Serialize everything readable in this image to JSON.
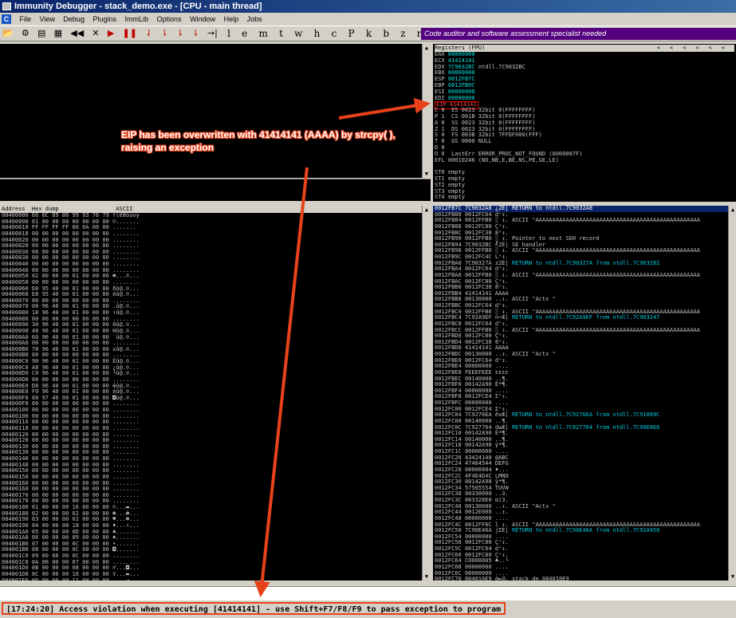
{
  "window": {
    "title": "Immunity Debugger - stack_demo.exe - [CPU - main thread]"
  },
  "menu": [
    "File",
    "View",
    "Debug",
    "Plugins",
    "ImmLib",
    "Options",
    "Window",
    "Help",
    "Jobs"
  ],
  "toolbar": {
    "controls": [
      "◀◀",
      "✕",
      "▶",
      "❚❚",
      "⇃",
      "⇂",
      "⇂",
      "⇂",
      "→|"
    ],
    "letters": [
      "l",
      "e",
      "m",
      "t",
      "w",
      "h",
      "c",
      "P",
      "k",
      "b",
      "z",
      "r",
      "...",
      "s",
      "?"
    ],
    "banner": "Code auditor and software assessment specialist needed"
  },
  "registers": {
    "header": "Registers (FPU)",
    "rows": [
      {
        "name": "EAX",
        "value": "00000000",
        "comment": ""
      },
      {
        "name": "ECX",
        "value": "41414141",
        "comment": ""
      },
      {
        "name": "EDX",
        "value": "7C9032BC",
        "comment": "ntdll.7C9032BC"
      },
      {
        "name": "EBX",
        "value": "00000000",
        "comment": ""
      },
      {
        "name": "ESP",
        "value": "0012FB7C",
        "comment": ""
      },
      {
        "name": "EBP",
        "value": "0012FB9C",
        "comment": ""
      },
      {
        "name": "ESI",
        "value": "00000000",
        "comment": ""
      },
      {
        "name": "EDI",
        "value": "00000000",
        "comment": ""
      }
    ],
    "eip": "EIP 41414141",
    "flags": [
      "C 0  ES 0023 32bit 0(FFFFFFFF)",
      "P 1  CS 001B 32bit 0(FFFFFFFF)",
      "A 0  SS 0023 32bit 0(FFFFFFFF)",
      "Z 1  DS 0023 32bit 0(FFFFFFFF)",
      "S 0  FS 003B 32bit 7FFDF000(FFF)",
      "T 0  GS 0000 NULL",
      "D 0",
      "O 0  LastErr ERROR_PROC_NOT_FOUND (0000007F)",
      "EFL 00010246 (NO,NB,E,BE,NS,PE,GE,LE)",
      "",
      "ST0 empty",
      "ST1 empty",
      "ST2 empty",
      "ST3 empty",
      "ST4 empty"
    ]
  },
  "dump": {
    "header": "Address  Hex dump                 ASCII",
    "rows": [
      "00400000 66 6C 89 86 99 93 76 79 flë8öùvy",
      "00400008 01 00 00 00 00 00 00 00 ☺.......",
      "00400010 FF FF FF FF 00 0A 00 00 .......",
      "00400018 00 00 00 00 00 00 00 00 ........",
      "00400020 00 00 00 00 00 00 00 00 ........",
      "00400028 00 00 00 00 00 00 00 00 ........",
      "00400030 00 00 00 00 00 00 00 00 ........",
      "00400038 00 00 00 00 00 00 00 00 ........",
      "00400040 00 00 00 00 00 00 00 00 ........",
      "00400048 00 00 00 00 00 00 00 00 ........",
      "00400050 02 00 00 00 01 00 00 00 ☻...☺...",
      "00400058 00 00 00 00 00 00 00 00 ........",
      "00400060 D0 95 40 00 01 00 00 00 ðò@.☺...",
      "00400068 E8 95 40 00 01 00 00 00 èò@.☺...",
      "00400070 00 00 00 00 00 00 00 00 ........",
      "00400078 00 96 40 00 01 00 00 00 .û@.☺...",
      "00400080 18 96 40 00 01 00 00 00 ↑û@.☺...",
      "00400088 00 00 00 00 00 00 00 00 ........",
      "00400090 30 96 40 00 01 00 00 00 0û@.☺...",
      "00400098 48 96 40 00 01 00 00 00 Hû@.☺...",
      "004000A0 60 96 40 00 01 00 00 00 `û@.☺...",
      "004000A8 00 00 00 00 00 00 00 00 ........",
      "004000B0 78 96 40 00 01 00 00 00 xû@.☺...",
      "004000B8 00 00 00 00 00 00 00 00 ........",
      "004000C0 90 96 40 00 01 00 00 00 Éû@.☺...",
      "004000C8 A8 96 40 00 01 00 00 00 ¿û@.☺...",
      "004000D0 C0 96 40 00 01 00 00 00 └û@.☺...",
      "004000D8 00 00 00 00 00 00 00 00 ........",
      "004000E0 D8 96 40 00 01 00 00 00 ╪û@.☺...",
      "004000E8 F0 96 40 00 01 00 00 00 ≡û@.☺...",
      "004000F0 08 97 40 00 01 00 00 00 ◘ù@.☺...",
      "004000F8 00 00 00 00 00 00 00 00 ........",
      "00400100 00 00 00 00 00 00 00 00 ........",
      "00400108 00 00 00 00 00 00 00 00 ........",
      "00400110 00 00 00 00 00 00 00 00 ........",
      "00400118 00 00 00 00 00 00 00 00 ........",
      "00400120 00 00 00 00 00 00 00 00 ........",
      "00400128 00 00 00 00 00 00 00 00 ........",
      "00400130 00 00 00 00 00 00 00 00 ........",
      "00400138 00 00 00 00 00 00 00 00 ........",
      "00400140 00 00 00 00 00 00 00 00 ........",
      "00400148 00 00 00 00 00 00 00 00 ........",
      "00400150 00 00 00 00 00 00 00 00 ........",
      "00400158 00 00 00 00 00 00 00 00 ........",
      "00400160 00 00 00 00 00 00 00 00 ........",
      "00400168 00 00 00 00 00 00 00 00 ........",
      "00400170 00 00 00 00 00 00 00 00 ........",
      "00400178 00 00 00 00 00 00 00 00 ........",
      "00400180 01 00 00 00 16 00 00 00 ☺...▬...",
      "00400188 02 00 00 00 02 00 00 00 ☻...☻...",
      "00400190 03 00 00 00 02 00 00 00 ♥...☻...",
      "00400198 04 00 00 00 18 00 00 00 ♦...↑...",
      "004001A0 05 00 00 00 0D 00 00 00 ♣.......",
      "004001A8 06 00 00 00 09 00 00 00 ♠.......",
      "004001B0 07 00 00 00 0C 00 00 00 •.......",
      "004001B8 08 00 00 00 0C 00 00 00 ◘.......",
      "004001C0 09 00 00 00 0C 00 00 00 ........",
      "004001C8 0A 00 00 00 07 00 00 00 ........",
      "004001D0 0B 00 00 00 08 00 00 00 ♂...◘...",
      "004001D8 0C 00 00 00 16 00 00 00 ♀...▬...",
      "004001E0 0D 00 00 00 11 00 00 00 ....◄..."
    ]
  },
  "stack": {
    "rows": [
      {
        "addr": "0012FB7C",
        "val": "7C9032A8",
        "asc": "¿2É|",
        "cmt": "RETURN to ntdll.7C9032A8",
        "sel": true
      },
      {
        "addr": "0012FB80",
        "val": "0012FC64",
        "asc": "dⁿ↕.",
        "cmt": ""
      },
      {
        "addr": "0012FB84",
        "val": "0012FFB0",
        "asc": "░ ↕.",
        "cmt": "ASCII \"AAAAAAAAAAAAAAAAAAAAAAAAAAAAAAAAAAAAAAAAAAAAAAAAA"
      },
      {
        "addr": "0012FB88",
        "val": "0012FC80",
        "asc": "Çⁿ↕.",
        "cmt": ""
      },
      {
        "addr": "0012FB8C",
        "val": "0012FC38",
        "asc": "8ⁿ↕.",
        "cmt": ""
      },
      {
        "addr": "0012FB90",
        "val": "0012FFB0",
        "asc": "░ ↕.",
        "cmt": "Pointer to next SEH record"
      },
      {
        "addr": "0012FB94",
        "val": "7C9032BC",
        "asc": "╝2É|",
        "cmt": "SE handler"
      },
      {
        "addr": "0012FB98",
        "val": "0012FFB0",
        "asc": "░ ↕.",
        "cmt": "ASCII \"AAAAAAAAAAAAAAAAAAAAAAAAAAAAAAAAAAAAAAAAAAAAAAAAA"
      },
      {
        "addr": "0012FB9C",
        "val": "0012FC4C",
        "asc": "Lⁿ↕.",
        "cmt": ""
      },
      {
        "addr": "0012FBA0",
        "val": "7C90327A",
        "asc": "z2É|",
        "cmt": "RETURN to ntdll.7C90327A from ntdll.7C903282"
      },
      {
        "addr": "0012FBA4",
        "val": "0012FC64",
        "asc": "dⁿ↕.",
        "cmt": ""
      },
      {
        "addr": "0012FBA8",
        "val": "0012FFB0",
        "asc": "░ ↕.",
        "cmt": "ASCII \"AAAAAAAAAAAAAAAAAAAAAAAAAAAAAAAAAAAAAAAAAAAAAAAAA"
      },
      {
        "addr": "0012FBAC",
        "val": "0012FC80",
        "asc": "Çⁿ↕.",
        "cmt": ""
      },
      {
        "addr": "0012FBB0",
        "val": "0012FC38",
        "asc": "8ⁿ↕.",
        "cmt": ""
      },
      {
        "addr": "0012FBB4",
        "val": "41414141",
        "asc": "AAAA",
        "cmt": ""
      },
      {
        "addr": "0012FBB8",
        "val": "00130000",
        "asc": "..↕.",
        "cmt": "ASCII \"Actx \""
      },
      {
        "addr": "0012FBBC",
        "val": "0012FC64",
        "asc": "dⁿ↕.",
        "cmt": ""
      },
      {
        "addr": "0012FBC0",
        "val": "0012FFB0",
        "asc": "░ ↕.",
        "cmt": "ASCII \"AAAAAAAAAAAAAAAAAAAAAAAAAAAAAAAAAAAAAAAAAAAAAAAAA"
      },
      {
        "addr": "0012FBC4",
        "val": "7C92A9EF",
        "asc": "n⌐Æ|",
        "cmt": "RETURN to ntdll.7C92A9EF from ntdll.7C903247"
      },
      {
        "addr": "0012FBC8",
        "val": "0012FC64",
        "asc": "dⁿ↕.",
        "cmt": ""
      },
      {
        "addr": "0012FBCC",
        "val": "0012FFB0",
        "asc": "░ ↕.",
        "cmt": "ASCII \"AAAAAAAAAAAAAAAAAAAAAAAAAAAAAAAAAAAAAAAAAAAAAAAAA"
      },
      {
        "addr": "0012FBD0",
        "val": "0012FC80",
        "asc": "Çⁿ↕.",
        "cmt": ""
      },
      {
        "addr": "0012FBD4",
        "val": "0012FC38",
        "asc": "8ⁿ↕.",
        "cmt": ""
      },
      {
        "addr": "0012FBD8",
        "val": "41414141",
        "asc": "AAAA",
        "cmt": ""
      },
      {
        "addr": "0012FBDC",
        "val": "00130000",
        "asc": "..↕.",
        "cmt": "ASCII \"Actx \""
      },
      {
        "addr": "0012FBE0",
        "val": "0012FC64",
        "asc": "dⁿ↕.",
        "cmt": ""
      },
      {
        "addr": "0012FBE4",
        "val": "00000000",
        "asc": "....",
        "cmt": ""
      },
      {
        "addr": "0012FBE8",
        "val": "FEEEFEEE",
        "asc": "εεεε",
        "cmt": ""
      },
      {
        "addr": "0012FBEC",
        "val": "00140000",
        "asc": "..¶.",
        "cmt": ""
      },
      {
        "addr": "0012FBF0",
        "val": "00142A90",
        "asc": "É*¶.",
        "cmt": ""
      },
      {
        "addr": "0012FBF4",
        "val": "00000000",
        "asc": "....",
        "cmt": ""
      },
      {
        "addr": "0012FBF8",
        "val": "0012FCE4",
        "asc": "Σⁿ↕.",
        "cmt": ""
      },
      {
        "addr": "0012FBFC",
        "val": "00000000",
        "asc": "....",
        "cmt": ""
      },
      {
        "addr": "0012FC00",
        "val": "0012FCE4",
        "asc": "Σⁿ↕.",
        "cmt": ""
      },
      {
        "addr": "0012FC04",
        "val": "7C9276EA",
        "asc": "êvÆ|",
        "cmt": "RETURN to ntdll.7C9276EA from ntdll.7C91069C"
      },
      {
        "addr": "0012FC08",
        "val": "00140000",
        "asc": "..¶.",
        "cmt": ""
      },
      {
        "addr": "0012FC0C",
        "val": "7C927764",
        "asc": "dwÆ|",
        "cmt": "RETURN to ntdll.7C927764 from ntdll.7C90E8E6"
      },
      {
        "addr": "0012FC10",
        "val": "00142A90",
        "asc": "É*¶.",
        "cmt": ""
      },
      {
        "addr": "0012FC14",
        "val": "00140000",
        "asc": "..¶.",
        "cmt": ""
      },
      {
        "addr": "0012FC18",
        "val": "00142A98",
        "asc": "ÿ*¶.",
        "cmt": ""
      },
      {
        "addr": "0012FC1C",
        "val": "00000000",
        "asc": "....",
        "cmt": ""
      },
      {
        "addr": "0012FC20",
        "val": "43424140",
        "asc": "@ABC",
        "cmt": ""
      },
      {
        "addr": "0012FC24",
        "val": "47464544",
        "asc": "DEFG",
        "cmt": ""
      },
      {
        "addr": "0012FC28",
        "val": "00000004",
        "asc": "♦...",
        "cmt": ""
      },
      {
        "addr": "0012FC2C",
        "val": "4F4E4D4C",
        "asc": "LMNO",
        "cmt": ""
      },
      {
        "addr": "0012FC30",
        "val": "00142A98",
        "asc": "ÿ*¶.",
        "cmt": ""
      },
      {
        "addr": "0012FC34",
        "val": "57565554",
        "asc": "TUVW",
        "cmt": ""
      },
      {
        "addr": "0012FC38",
        "val": "00330000",
        "asc": "..3.",
        "cmt": ""
      },
      {
        "addr": "0012FC3C",
        "val": "003328E0",
        "asc": "α(3.",
        "cmt": ""
      },
      {
        "addr": "0012FC40",
        "val": "00130000",
        "asc": "..↕.",
        "cmt": "ASCII \"Actx \""
      },
      {
        "addr": "0012FC44",
        "val": "0012E000",
        "asc": "..↕.",
        "cmt": ""
      },
      {
        "addr": "0012FC48",
        "val": "00000000",
        "asc": "....",
        "cmt": ""
      },
      {
        "addr": "0012FC4C",
        "val": "0012FF6C",
        "asc": "l ↕.",
        "cmt": "ASCII \"AAAAAAAAAAAAAAAAAAAAAAAAAAAAAAAAAAAAAAAAAAAAAAAAA"
      },
      {
        "addr": "0012FC50",
        "val": "7C90E46A",
        "asc": "jΣÉ|",
        "cmt": "RETURN to ntdll.7C90E46A from ntdll.7C92A950"
      },
      {
        "addr": "0012FC54",
        "val": "00000000",
        "asc": "....",
        "cmt": ""
      },
      {
        "addr": "0012FC58",
        "val": "0012FC80",
        "asc": "Çⁿ↕.",
        "cmt": ""
      },
      {
        "addr": "0012FC5C",
        "val": "0012FC64",
        "asc": "dⁿ↕.",
        "cmt": ""
      },
      {
        "addr": "0012FC60",
        "val": "0012FC80",
        "asc": "Çⁿ↕.",
        "cmt": ""
      },
      {
        "addr": "0012FC64",
        "val": "C0000005",
        "asc": "♣..└",
        "cmt": ""
      },
      {
        "addr": "0012FC68",
        "val": "00000000",
        "asc": "....",
        "cmt": ""
      },
      {
        "addr": "0012FC6C",
        "val": "00000000",
        "asc": "....",
        "cmt": ""
      },
      {
        "addr": "0012FC70",
        "val": "004010E9",
        "asc": "é►@.",
        "cmt": "stack_de.004010E9"
      },
      {
        "addr": "0012FC74",
        "val": "00000002",
        "asc": "☻...",
        "cmt": ""
      }
    ]
  },
  "annotation": {
    "text": "EIP has been overwritten with 41414141 (AAAA) by strcpy( ), raising an exception"
  },
  "status": {
    "message": "[17:24:20] Access violation when executing [41414141] - use Shift+F7/F8/F9 to pass exception to program"
  },
  "colors": {
    "accent_arrow": "#e8421c",
    "banner_bg": "#55007f"
  }
}
